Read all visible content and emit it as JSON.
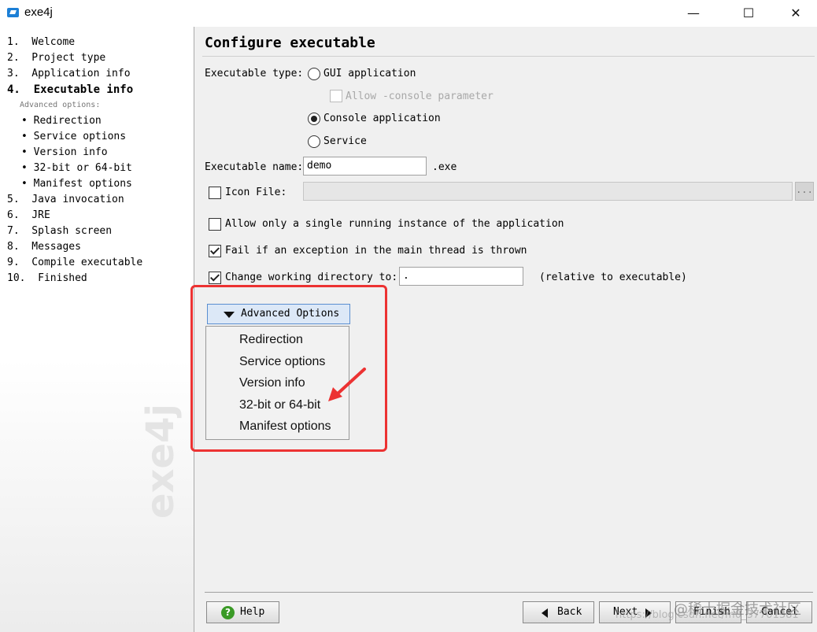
{
  "window": {
    "title": "exe4j",
    "minimize_glyph": "—",
    "maximize_glyph": "☐",
    "close_glyph": "✕",
    "accent_color": "#1c7fd6"
  },
  "steps": [
    {
      "label": "1.  Welcome"
    },
    {
      "label": "2.  Project type"
    },
    {
      "label": "3.  Application info"
    },
    {
      "label": "4.  Executable info"
    },
    {
      "label": "Advanced options:"
    },
    {
      "label": "• Redirection"
    },
    {
      "label": "• Service options"
    },
    {
      "label": "• Version info"
    },
    {
      "label": "• 32-bit or 64-bit"
    },
    {
      "label": "• Manifest options"
    },
    {
      "label": "5.  Java invocation"
    },
    {
      "label": "6.  JRE"
    },
    {
      "label": "7.  Splash screen"
    },
    {
      "label": "8.  Messages"
    },
    {
      "label": "9.  Compile executable"
    },
    {
      "label": "10.  Finished"
    }
  ],
  "sidebar_logo": "exe4j",
  "page": {
    "title": "Configure executable",
    "executable_type_label": "Executable type:",
    "gui_option": "GUI application",
    "allow_console_label": "Allow -console parameter",
    "console_option": "Console application",
    "service_option": "Service",
    "selected_type": "Console application",
    "executable_name_label": "Executable name:",
    "executable_name_value": "demo",
    "exe_suffix": ".exe",
    "icon_file_label": "Icon File:",
    "icon_file_value": "",
    "icon_file_checked": false,
    "browse_glyph": "...",
    "single_instance_label": "Allow only a single running instance of the application",
    "single_instance_checked": false,
    "fail_exception_label": "Fail if an exception in the main thread is thrown",
    "fail_exception_checked": true,
    "change_dir_label": "Change working directory to:",
    "change_dir_checked": true,
    "working_dir_value": ".",
    "relative_label": "(relative to executable)"
  },
  "advanced": {
    "button_label": "Advanced Options",
    "menu_items": [
      "Redirection",
      "Service options",
      "Version info",
      "32-bit or 64-bit",
      "Manifest options"
    ],
    "highlight_color": "#ec3232"
  },
  "footer": {
    "help_label": "Help",
    "help_icon_glyph": "?",
    "back_label": "Back",
    "next_label": "Next",
    "finish_label": "Finish",
    "cancel_label": "Cancel"
  },
  "watermark": {
    "line1": "@稀土掘金技术社区",
    "line2": "https://blog.csdn.net/m0_37701381"
  }
}
